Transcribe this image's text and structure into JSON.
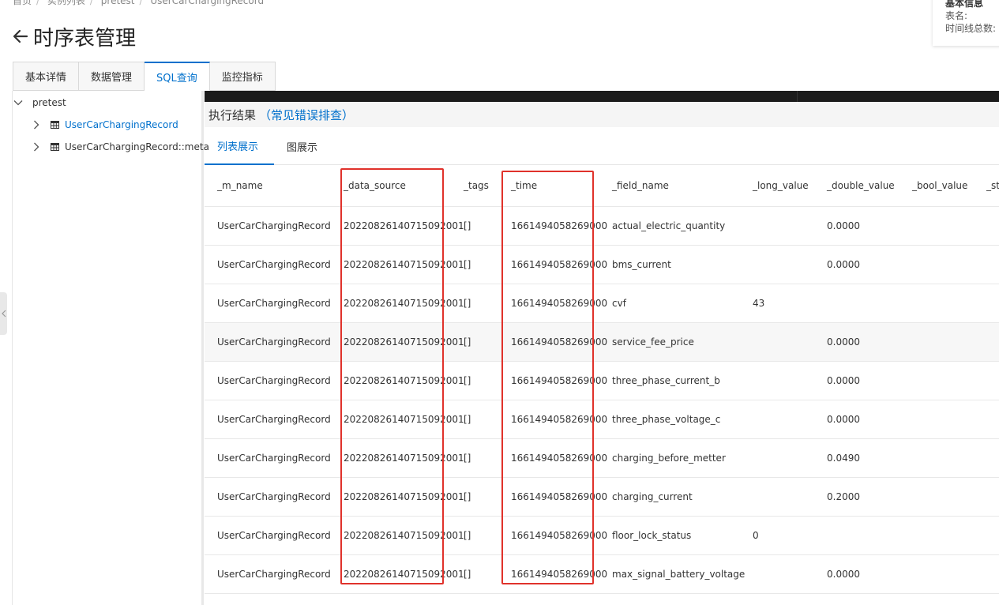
{
  "breadcrumb": [
    "首页",
    "实例列表",
    "pretest",
    "UserCarChargingRecord"
  ],
  "info_card": {
    "title": "基本信息",
    "table_label": "表名:",
    "series_label": "时间线总数:"
  },
  "page_title": "时序表管理",
  "tabs": [
    {
      "label": "基本详情",
      "active": false
    },
    {
      "label": "数据管理",
      "active": false
    },
    {
      "label": "SQL查询",
      "active": true
    },
    {
      "label": "监控指标",
      "active": false
    }
  ],
  "tree": {
    "root": "pretest",
    "items": [
      {
        "label": "UserCarChargingRecord",
        "selected": true
      },
      {
        "label": "UserCarChargingRecord::meta",
        "selected": false
      }
    ]
  },
  "result": {
    "title": "执行结果",
    "help_link": "（常见错误排查）",
    "view_tabs": [
      {
        "label": "列表展示",
        "active": true
      },
      {
        "label": "图展示",
        "active": false
      }
    ],
    "columns": [
      "_m_name",
      "_data_source",
      "_tags",
      "_time",
      "_field_name",
      "_long_value",
      "_double_value",
      "_bool_value",
      "_str"
    ],
    "rows": [
      [
        "UserCarChargingRecord",
        "20220826140715092001",
        "[]",
        "1661494058269000",
        "actual_electric_quantity",
        "",
        "0.0000",
        "",
        ""
      ],
      [
        "UserCarChargingRecord",
        "20220826140715092001",
        "[]",
        "1661494058269000",
        "bms_current",
        "",
        "0.0000",
        "",
        ""
      ],
      [
        "UserCarChargingRecord",
        "20220826140715092001",
        "[]",
        "1661494058269000",
        "cvf",
        "43",
        "",
        "",
        ""
      ],
      [
        "UserCarChargingRecord",
        "20220826140715092001",
        "[]",
        "1661494058269000",
        "service_fee_price",
        "",
        "0.0000",
        "",
        ""
      ],
      [
        "UserCarChargingRecord",
        "20220826140715092001",
        "[]",
        "1661494058269000",
        "three_phase_current_b",
        "",
        "0.0000",
        "",
        ""
      ],
      [
        "UserCarChargingRecord",
        "20220826140715092001",
        "[]",
        "1661494058269000",
        "three_phase_voltage_c",
        "",
        "0.0000",
        "",
        ""
      ],
      [
        "UserCarChargingRecord",
        "20220826140715092001",
        "[]",
        "1661494058269000",
        "charging_before_metter",
        "",
        "0.0490",
        "",
        ""
      ],
      [
        "UserCarChargingRecord",
        "20220826140715092001",
        "[]",
        "1661494058269000",
        "charging_current",
        "",
        "0.2000",
        "",
        ""
      ],
      [
        "UserCarChargingRecord",
        "20220826140715092001",
        "[]",
        "1661494058269000",
        "floor_lock_status",
        "0",
        "",
        "",
        ""
      ],
      [
        "UserCarChargingRecord",
        "20220826140715092001",
        "[]",
        "1661494058269000",
        "max_signal_battery_voltage",
        "",
        "0.0000",
        "",
        ""
      ]
    ]
  },
  "colors": {
    "accent": "#0070cc",
    "highlight_box": "#e0322b",
    "dark_strip": "#1b1b1b"
  }
}
